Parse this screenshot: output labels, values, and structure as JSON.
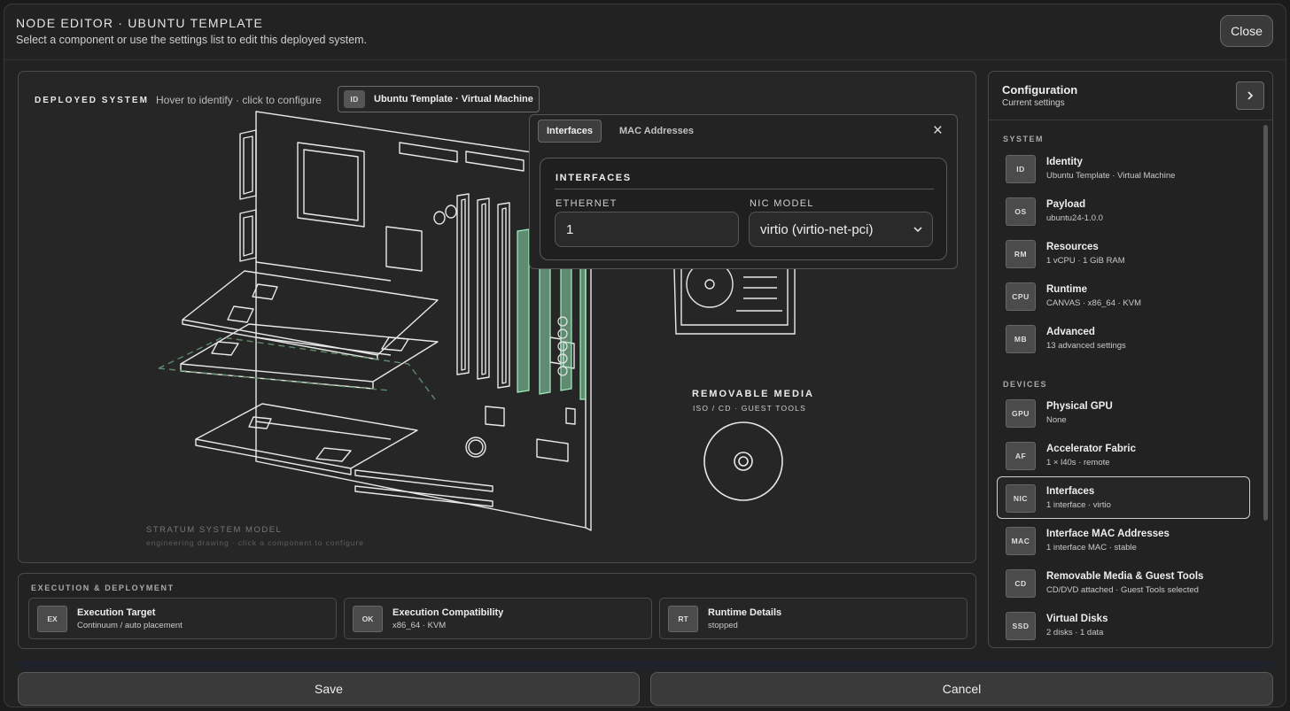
{
  "header": {
    "title": "NODE EDITOR · UBUNTU TEMPLATE",
    "subtitle": "Select a component or use the settings list to edit this deployed system.",
    "close_label": "Close"
  },
  "canvas": {
    "label": "DEPLOYED SYSTEM",
    "hint": "Hover to identify · click to configure",
    "chip_tag": "ID",
    "chip_label": "Ubuntu Template · Virtual Machine",
    "model_label": "STRATUM SYSTEM MODEL",
    "model_sub": "engineering drawing · click a component to configure",
    "removable_title": "REMOVABLE MEDIA",
    "removable_sub": "ISO / CD · GUEST TOOLS"
  },
  "popover": {
    "tabs": [
      "Interfaces",
      "MAC Addresses"
    ],
    "active_tab": "Interfaces",
    "close_icon": "×",
    "section_title": "INTERFACES",
    "ethernet_label": "ETHERNET",
    "ethernet_value": "1",
    "nic_label": "NIC MODEL",
    "nic_value": "virtio (virtio-net-pci)"
  },
  "config": {
    "title": "Configuration",
    "subtitle": "Current settings",
    "sections": [
      {
        "label": "SYSTEM",
        "items": [
          {
            "tag": "ID",
            "title": "Identity",
            "sub": "Ubuntu Template · Virtual Machine"
          },
          {
            "tag": "OS",
            "title": "Payload",
            "sub": "ubuntu24-1.0.0"
          },
          {
            "tag": "RM",
            "title": "Resources",
            "sub": "1 vCPU · 1 GiB RAM"
          },
          {
            "tag": "CPU",
            "title": "Runtime",
            "sub": "CANVAS · x86_64 · KVM"
          },
          {
            "tag": "MB",
            "title": "Advanced",
            "sub": "13 advanced settings"
          }
        ]
      },
      {
        "label": "DEVICES",
        "items": [
          {
            "tag": "GPU",
            "title": "Physical GPU",
            "sub": "None"
          },
          {
            "tag": "AF",
            "title": "Accelerator Fabric",
            "sub": "1 × l40s · remote"
          },
          {
            "tag": "NIC",
            "title": "Interfaces",
            "sub": "1 interface · virtio",
            "selected": true
          },
          {
            "tag": "MAC",
            "title": "Interface MAC Addresses",
            "sub": "1 interface MAC · stable"
          },
          {
            "tag": "CD",
            "title": "Removable Media & Guest Tools",
            "sub": "CD/DVD attached · Guest Tools selected"
          },
          {
            "tag": "SSD",
            "title": "Virtual Disks",
            "sub": "2 disks · 1 data"
          }
        ]
      }
    ]
  },
  "execution": {
    "title": "EXECUTION & DEPLOYMENT",
    "cards": [
      {
        "tag": "EX",
        "title": "Execution Target",
        "sub": "Continuum / auto placement"
      },
      {
        "tag": "OK",
        "title": "Execution Compatibility",
        "sub": "x86_64 · KVM"
      },
      {
        "tag": "RT",
        "title": "Runtime Details",
        "sub": "stopped"
      }
    ]
  },
  "footer": {
    "save_label": "Save",
    "cancel_label": "Cancel"
  },
  "colors": {
    "accent_green": "#7fd4a0",
    "panel_bg": "#222222",
    "border": "#4a4a4a"
  }
}
